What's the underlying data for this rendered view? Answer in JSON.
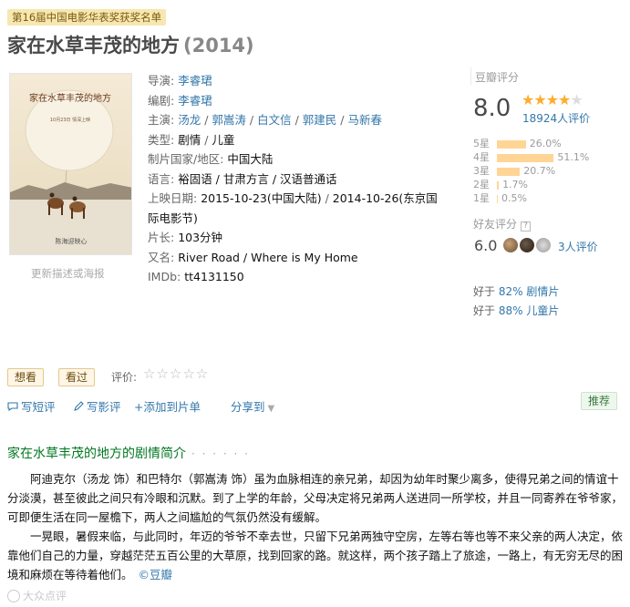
{
  "award_tag": "第16届中国电影华表奖获奖名单",
  "title": {
    "main": "家在水草丰茂的地方",
    "year": "(2014)"
  },
  "poster": {
    "calligraphy": "家在水草丰茂的地方",
    "date_text": "10月23日 情深上映",
    "bottom_text": "陈海迎映心",
    "link": "更新描述或海报"
  },
  "info": {
    "director": {
      "label": "导演:",
      "value": "李睿珺"
    },
    "writer": {
      "label": "编剧:",
      "value": "李睿珺"
    },
    "cast": {
      "label": "主演:",
      "names": [
        "汤龙",
        "郭嵩涛",
        "白文信",
        "郭建民",
        "马新春"
      ]
    },
    "genre": {
      "label": "类型:",
      "values": [
        "剧情",
        "儿童"
      ]
    },
    "country": {
      "label": "制片国家/地区:",
      "value": "中国大陆"
    },
    "language": {
      "label": "语言:",
      "value": "裕固语 / 甘肃方言 / 汉语普通话"
    },
    "release": {
      "label": "上映日期:",
      "values": [
        "2015-10-23(中国大陆)",
        "2014-10-26(东京国际电影节)"
      ]
    },
    "runtime": {
      "label": "片长:",
      "value": "103分钟"
    },
    "aka": {
      "label": "又名:",
      "value": "River Road / Where is My Home"
    },
    "imdb": {
      "label": "IMDb:",
      "value": "tt4131150"
    }
  },
  "rating": {
    "label": "豆瓣评分",
    "score": "8.0",
    "stars": 4,
    "votes": "18924人评价",
    "distribution": [
      {
        "label": "5星",
        "percent": 26.0,
        "text": "26.0%"
      },
      {
        "label": "4星",
        "percent": 51.1,
        "text": "51.1%"
      },
      {
        "label": "3星",
        "percent": 20.7,
        "text": "20.7%"
      },
      {
        "label": "2星",
        "percent": 1.7,
        "text": "1.7%"
      },
      {
        "label": "1星",
        "percent": 0.5,
        "text": "0.5%"
      }
    ],
    "friends": {
      "label": "好友评分",
      "help": "?",
      "score": "6.0",
      "count": "3人评价"
    },
    "better_than": [
      {
        "prefix": "好于",
        "percent": "82%",
        "genre": "剧情片"
      },
      {
        "prefix": "好于",
        "percent": "88%",
        "genre": "儿童片"
      }
    ]
  },
  "actions": {
    "want": "想看",
    "seen": "看过",
    "rate_label": "评价:",
    "rate_stars": "☆☆☆☆☆",
    "write_short": "写短评",
    "write_review": "写影评",
    "add_to_list": "+添加到片单",
    "share": "分享到",
    "recommend": "推荐"
  },
  "synopsis": {
    "heading": "家在水草丰茂的地方的剧情简介",
    "dots": "· · · · · ·",
    "paragraphs": [
      "阿迪克尔（汤龙 饰）和巴特尔（郭嵩涛 饰）虽为血脉相连的亲兄弟，却因为幼年时聚少离多，使得兄弟之间的情谊十分淡漠，甚至彼此之间只有冷眼和沉默。到了上学的年龄，父母决定将兄弟两人送进同一所学校，并且一同寄养在爷爷家，可即便生活在同一屋檐下，两人之间尴尬的气氛仍然没有缓解。",
      "一晃眼，暑假来临，与此同时，年迈的爷爷不幸去世，只留下兄弟两独守空房，左等右等也等不来父亲的两人决定，依靠他们自己的力量，穿越茫茫五百公里的大草原，找到回家的路。就这样，两个孩子踏上了旅途，一路上，有无穷无尽的困境和麻烦在等待着他们。"
    ],
    "copyright": "©豆瓣"
  },
  "watermark": "大众点评",
  "colors": {
    "link": "#3377aa",
    "star": "#ffac2d",
    "bar": "#ffd596",
    "synopsis_heading": "#007722",
    "tag_bg": "#f7e7b0"
  }
}
